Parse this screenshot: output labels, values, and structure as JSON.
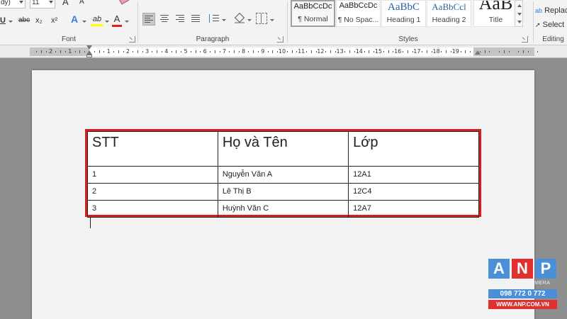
{
  "ribbon": {
    "font_group": {
      "label": "Font",
      "font_name": "dy)",
      "font_size": "11",
      "strikethrough": "abc",
      "subscript": "x₂",
      "superscript": "x²",
      "underline": "U",
      "font_color_letter": "A",
      "highlight_label": "ab",
      "text_effect_letter": "A",
      "grow_letter": "A",
      "shrink_letter": "A"
    },
    "paragraph_group": {
      "label": "Paragraph"
    },
    "styles_group": {
      "label": "Styles",
      "styles": [
        {
          "sample": "AaBbCcDc",
          "name": "¶ Normal",
          "selected": true
        },
        {
          "sample": "AaBbCcDc",
          "name": "¶ No Spac...",
          "selected": false
        },
        {
          "sample": "AaBbC",
          "name": "Heading 1",
          "selected": false
        },
        {
          "sample": "AaBbCcl",
          "name": "Heading 2",
          "selected": false
        },
        {
          "sample": "AaB",
          "name": "Title",
          "selected": false
        }
      ]
    },
    "editing_group": {
      "label": "Editing",
      "replace": "Replac",
      "select": "Select"
    }
  },
  "ruler": {
    "left_numbers": [
      "2",
      "1"
    ],
    "right_numbers": [
      "1",
      "2",
      "3",
      "4",
      "5",
      "6",
      "7",
      "8",
      "9",
      "10",
      "11",
      "12",
      "13",
      "14",
      "15",
      "16",
      "17",
      "18",
      "19"
    ]
  },
  "document": {
    "table": {
      "headers": [
        "STT",
        "Họ và Tên",
        "Lớp"
      ],
      "rows": [
        [
          "1",
          "Nguyễn Văn A",
          "12A1"
        ],
        [
          "2",
          "Lê Thị B",
          "12C4"
        ],
        [
          "3",
          "Huỳnh Văn C",
          "12A7"
        ]
      ],
      "highlight_color": "#d42020"
    }
  },
  "watermark": {
    "letters": [
      "A",
      "N",
      "P"
    ],
    "letter_colors": [
      "#4a90d9",
      "#e03030",
      "#4a90d9"
    ],
    "subtitle": "MÁY TÍNH - CAMERA",
    "phone": "098 772 0 772",
    "website": "WWW.ANP.COM.VN"
  }
}
